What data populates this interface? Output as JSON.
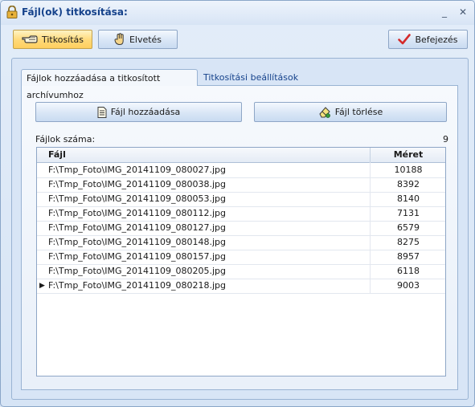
{
  "window": {
    "title": "Fájl(ok) titkosítása:",
    "minimize_label": "_",
    "close_label": "✕"
  },
  "toolbar": {
    "encrypt_label": "Titkosítás",
    "discard_label": "Elvetés",
    "finish_label": "Befejezés"
  },
  "tabs": [
    {
      "label": "Fájlok hozzáadása a titkosított archívumhoz",
      "active": true
    },
    {
      "label": "Titkosítási beállítások",
      "active": false
    }
  ],
  "actions": {
    "add_file_label": "Fájl hozzáadása",
    "delete_file_label": "Fájl törlése"
  },
  "file_count": {
    "label": "Fájlok száma:",
    "value": "9"
  },
  "grid": {
    "columns": [
      "Fájl",
      "Méret"
    ],
    "rows": [
      {
        "file": "F:\\Tmp_Foto\\IMG_20141109_080027.jpg",
        "size": "10188"
      },
      {
        "file": "F:\\Tmp_Foto\\IMG_20141109_080038.jpg",
        "size": "8392"
      },
      {
        "file": "F:\\Tmp_Foto\\IMG_20141109_080053.jpg",
        "size": "8140"
      },
      {
        "file": "F:\\Tmp_Foto\\IMG_20141109_080112.jpg",
        "size": "7131"
      },
      {
        "file": "F:\\Tmp_Foto\\IMG_20141109_080127.jpg",
        "size": "6579"
      },
      {
        "file": "F:\\Tmp_Foto\\IMG_20141109_080148.jpg",
        "size": "8275"
      },
      {
        "file": "F:\\Tmp_Foto\\IMG_20141109_080157.jpg",
        "size": "8957"
      },
      {
        "file": "F:\\Tmp_Foto\\IMG_20141109_080205.jpg",
        "size": "6118"
      },
      {
        "file": "F:\\Tmp_Foto\\IMG_20141109_080218.jpg",
        "size": "9003"
      }
    ],
    "current_row_indicator": "▶"
  },
  "colors": {
    "title_text": "#15428b",
    "active_button": "#ffd978",
    "accent_check": "#d42a2a"
  }
}
